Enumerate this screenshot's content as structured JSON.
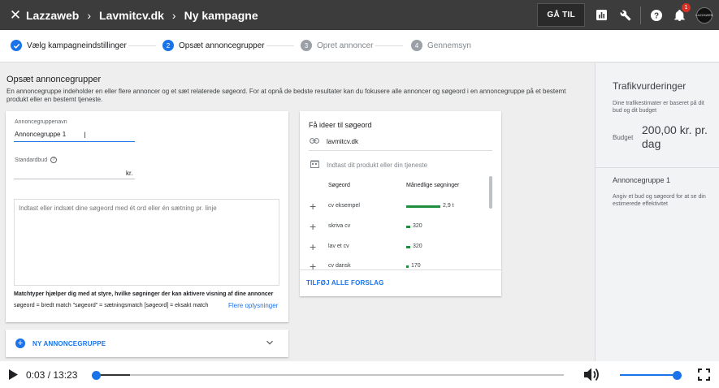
{
  "header": {
    "close_icon": "close-icon",
    "breadcrumbs": [
      "Lazzaweb",
      "Lavmitcv.dk",
      "Ny kampagne"
    ],
    "goto_label": "GÅ TIL",
    "notification_count": "1",
    "avatar_text": "LAZZAWEB"
  },
  "stepper": {
    "steps": [
      {
        "number": "1",
        "label": "Vælg kampagneindstillinger",
        "state": "done"
      },
      {
        "number": "2",
        "label": "Opsæt annoncegrupper",
        "state": "active"
      },
      {
        "number": "3",
        "label": "Opret annoncer",
        "state": "pending"
      },
      {
        "number": "4",
        "label": "Gennemsyn",
        "state": "pending"
      }
    ]
  },
  "main": {
    "title": "Opsæt annoncegrupper",
    "description": "En annoncegruppe indeholder en eller flere annoncer og et sæt relaterede søgeord. For at opnå de bedste resultater kan du fokusere alle annoncer og søgeord i en annoncegruppe på et bestemt produkt eller en bestemt tjeneste."
  },
  "adgroup": {
    "name_label": "Annoncegruppenavn",
    "name_value": "Annoncegruppe 1",
    "bid_label": "Standardbud",
    "bid_unit": "kr.",
    "keywords_placeholder": "Indtast eller indsæt dine søgeord med ét ord eller én sætning pr. linje",
    "match_title": "Matchtyper hjælper dig med at styre, hvilke søgninger der kan aktivere visning af dine annoncer",
    "match_text": "søgeord = bredt match   \"søgeord\" = sætningsmatch   [søgeord] = eksakt match",
    "more_info": "Flere oplysninger"
  },
  "new_adgroup": {
    "label": "NY ANNONCEGRUPPE"
  },
  "ideas": {
    "title": "Få ideer til søgeord",
    "url": "lavmitcv.dk",
    "product_placeholder": "Indtast dit produkt eller din tjeneste",
    "col_keyword": "Søgeord",
    "col_volume": "Månedlige søgninger",
    "rows": [
      {
        "keyword": "cv eksempel",
        "volume": "2,9 t",
        "volume_num": 2900
      },
      {
        "keyword": "skriva cv",
        "volume": "320",
        "volume_num": 320
      },
      {
        "keyword": "lav et cv",
        "volume": "320",
        "volume_num": 320
      },
      {
        "keyword": "cv dansk",
        "volume": "170",
        "volume_num": 170
      }
    ],
    "add_all": "TILFØJ ALLE FORSLAG"
  },
  "traffic": {
    "title": "Trafikvurderinger",
    "description": "Dine trafikestimater er baseret på dit bud og dit budget",
    "budget_label": "Budget",
    "budget_value": "200,00 kr. pr. dag",
    "group_name": "Annoncegruppe 1",
    "group_desc": "Angiv et bud og søgeord for at se din estimerede effektivitet"
  },
  "video": {
    "time": "0:03 / 13:23",
    "progress": 0.005,
    "volume": 1.0
  },
  "colors": {
    "accent": "#1a73e8",
    "topbar": "#3c3c3c",
    "bar_green": "#1e8e3e"
  }
}
